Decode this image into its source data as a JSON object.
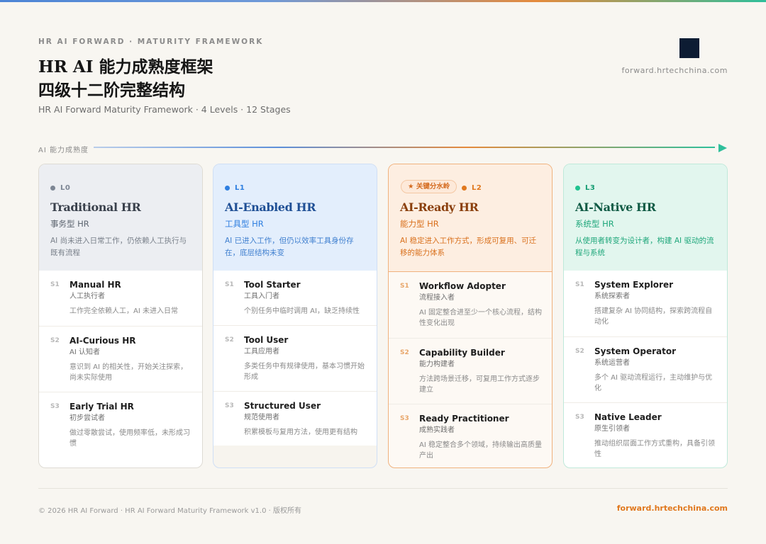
{
  "header": {
    "eyebrow": "HR AI FORWARD  ·  MATURITY FRAMEWORK",
    "title_line1": "HR AI 能力成熟度框架",
    "title_line2": "四级十二阶完整结构",
    "subtitle": "HR AI Forward Maturity Framework  ·  4 Levels  ·  12 Stages",
    "site": "forward.hrtechchina.com"
  },
  "axis": {
    "label": "AI 能力成熟度"
  },
  "colors": {
    "l0": "#7d8694",
    "l1": "#2f7fe0",
    "l2": "#e0781e",
    "l3": "#1fb486"
  },
  "levels": [
    {
      "code": "L0",
      "title": "Traditional HR",
      "sub": "事务型 HR",
      "desc": "AI 尚未进入日常工作，仍依赖人工执行与既有流程",
      "stages": [
        {
          "no": "S1",
          "name": "Manual HR",
          "cn": "人工执行者",
          "desc": "工作完全依赖人工，AI 未进入日常"
        },
        {
          "no": "S2",
          "name": "AI-Curious HR",
          "cn": "AI 认知者",
          "desc": "意识到 AI 的相关性，开始关注探索，尚未实际使用"
        },
        {
          "no": "S3",
          "name": "Early Trial HR",
          "cn": "初步尝试者",
          "desc": "做过零散尝试，使用频率低，未形成习惯"
        }
      ]
    },
    {
      "code": "L1",
      "title": "AI-Enabled HR",
      "sub": "工具型 HR",
      "desc": "AI 已进入工作，但仍以效率工具身份存在，底层结构未变",
      "stages": [
        {
          "no": "S1",
          "name": "Tool Starter",
          "cn": "工具入门者",
          "desc": "个别任务中临时调用 AI，缺乏持续性"
        },
        {
          "no": "S2",
          "name": "Tool User",
          "cn": "工具应用者",
          "desc": "多类任务中有规律使用，基本习惯开始形成"
        },
        {
          "no": "S3",
          "name": "Structured User",
          "cn": "规范使用者",
          "desc": "积累模板与复用方法，使用更有结构"
        }
      ]
    },
    {
      "code": "L2",
      "title": "AI-Ready HR",
      "sub": "能力型 HR",
      "badge": "★ 关键分水岭",
      "desc": "AI 稳定进入工作方式，形成可复用、可迁移的能力体系",
      "stages": [
        {
          "no": "S1",
          "name": "Workflow Adopter",
          "cn": "流程接入者",
          "desc": "AI 固定整合进至少一个核心流程，结构性变化出现"
        },
        {
          "no": "S2",
          "name": "Capability Builder",
          "cn": "能力构建者",
          "desc": "方法跨场景迁移，可复用工作方式逐步建立"
        },
        {
          "no": "S3",
          "name": "Ready Practitioner",
          "cn": "成熟实践者",
          "desc": "AI 稳定整合多个领域，持续输出高质量产出"
        }
      ]
    },
    {
      "code": "L3",
      "title": "AI-Native HR",
      "sub": "系统型 HR",
      "desc": "从使用者转变为设计者，构建 AI 驱动的流程与系统",
      "stages": [
        {
          "no": "S1",
          "name": "System Explorer",
          "cn": "系统探索者",
          "desc": "搭建复杂 AI 协同结构，探索跨流程自动化"
        },
        {
          "no": "S2",
          "name": "System Operator",
          "cn": "系统运营者",
          "desc": "多个 AI 驱动流程运行，主动维护与优化"
        },
        {
          "no": "S3",
          "name": "Native Leader",
          "cn": "原生引领者",
          "desc": "推动组织层面工作方式重构，具备引领性"
        }
      ]
    }
  ],
  "footer": {
    "left": "© 2026 HR AI Forward  ·  HR AI Forward Maturity Framework v1.0  ·  版权所有",
    "right": "forward.hrtechchina.com"
  }
}
